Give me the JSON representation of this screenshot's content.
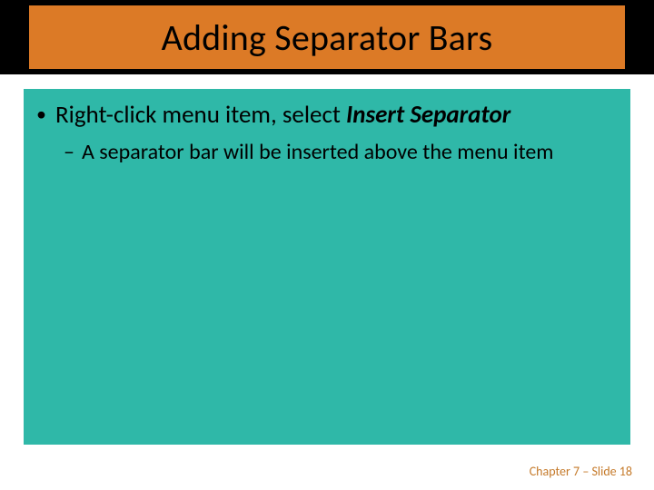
{
  "slide": {
    "title": "Adding Separator Bars",
    "bullet": {
      "prefix": "Right-click menu item, select ",
      "emphasis": "Insert Separator"
    },
    "sub": "A separator bar will be inserted above the menu item",
    "footer": "Chapter 7 – Slide 18"
  }
}
